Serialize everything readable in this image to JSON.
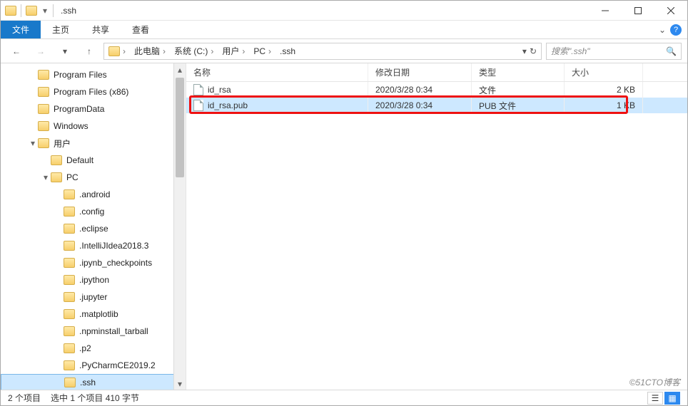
{
  "window": {
    "title": ".ssh"
  },
  "ribbon": {
    "tabs": {
      "file": "文件",
      "home": "主页",
      "share": "共享",
      "view": "查看"
    }
  },
  "breadcrumb": {
    "items": [
      "此电脑",
      "系统 (C:)",
      "用户",
      "PC",
      ".ssh"
    ]
  },
  "search": {
    "placeholder": "搜索\".ssh\""
  },
  "tree": {
    "items": [
      {
        "label": "Program Files",
        "indent": 1,
        "exp": ""
      },
      {
        "label": "Program Files (x86)",
        "indent": 1,
        "exp": ""
      },
      {
        "label": "ProgramData",
        "indent": 1,
        "exp": ""
      },
      {
        "label": "Windows",
        "indent": 1,
        "exp": ""
      },
      {
        "label": "用户",
        "indent": 1,
        "exp": "▾"
      },
      {
        "label": "Default",
        "indent": 2,
        "exp": ""
      },
      {
        "label": "PC",
        "indent": 2,
        "exp": "▾"
      },
      {
        "label": ".android",
        "indent": 3,
        "exp": ""
      },
      {
        "label": ".config",
        "indent": 3,
        "exp": ""
      },
      {
        "label": ".eclipse",
        "indent": 3,
        "exp": ""
      },
      {
        "label": ".IntelliJIdea2018.3",
        "indent": 3,
        "exp": ""
      },
      {
        "label": ".ipynb_checkpoints",
        "indent": 3,
        "exp": ""
      },
      {
        "label": ".ipython",
        "indent": 3,
        "exp": ""
      },
      {
        "label": ".jupyter",
        "indent": 3,
        "exp": ""
      },
      {
        "label": ".matplotlib",
        "indent": 3,
        "exp": ""
      },
      {
        "label": ".npminstall_tarball",
        "indent": 3,
        "exp": ""
      },
      {
        "label": ".p2",
        "indent": 3,
        "exp": ""
      },
      {
        "label": ".PyCharmCE2019.2",
        "indent": 3,
        "exp": ""
      },
      {
        "label": ".ssh",
        "indent": 3,
        "exp": "",
        "selected": true
      }
    ]
  },
  "columns": {
    "name": "名称",
    "date": "修改日期",
    "type": "类型",
    "size": "大小"
  },
  "files": [
    {
      "name": "id_rsa",
      "date": "2020/3/28 0:34",
      "type": "文件",
      "size": "2 KB",
      "selected": false
    },
    {
      "name": "id_rsa.pub",
      "date": "2020/3/28 0:34",
      "type": "PUB 文件",
      "size": "1 KB",
      "selected": true
    }
  ],
  "status": {
    "count": "2 个项目",
    "selection": "选中 1 个项目  410 字节"
  },
  "watermark": "©51CTO博客"
}
